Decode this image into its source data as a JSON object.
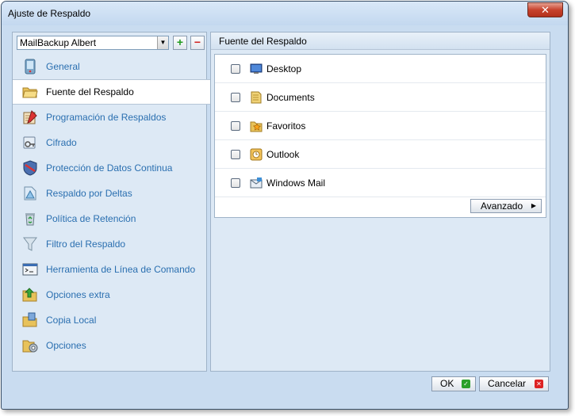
{
  "window": {
    "title": "Ajuste de Respaldo",
    "close_glyph": "✕"
  },
  "profile": {
    "selected": "MailBackup Albert",
    "add_glyph": "+",
    "remove_glyph": "−"
  },
  "nav": {
    "items": [
      {
        "label": "General",
        "icon": "mobile-icon"
      },
      {
        "label": "Fuente del Respaldo",
        "icon": "folder-open-icon",
        "active": true
      },
      {
        "label": "Programación de Respaldos",
        "icon": "schedule-icon"
      },
      {
        "label": "Cifrado",
        "icon": "key-icon"
      },
      {
        "label": "Protección de Datos Continua",
        "icon": "shield-icon"
      },
      {
        "label": "Respaldo por Deltas",
        "icon": "delta-icon"
      },
      {
        "label": "Política de Retención",
        "icon": "recycle-icon"
      },
      {
        "label": "Filtro del Respaldo",
        "icon": "funnel-icon"
      },
      {
        "label": "Herramienta de Línea de Comando",
        "icon": "terminal-icon"
      },
      {
        "label": "Opciones extra",
        "icon": "folder-arrow-icon"
      },
      {
        "label": "Copia Local",
        "icon": "folder-copy-icon"
      },
      {
        "label": "Opciones",
        "icon": "gear-folder-icon"
      }
    ]
  },
  "source_panel": {
    "header": "Fuente del Respaldo",
    "items": [
      {
        "label": "Desktop",
        "icon": "desktop-icon",
        "checked": false
      },
      {
        "label": "Documents",
        "icon": "documents-icon",
        "checked": false
      },
      {
        "label": "Favoritos",
        "icon": "favorites-star-icon",
        "checked": false
      },
      {
        "label": "Outlook",
        "icon": "outlook-icon",
        "checked": false
      },
      {
        "label": "Windows Mail",
        "icon": "windows-mail-icon",
        "checked": false
      }
    ],
    "advanced_label": "Avanzado",
    "advanced_arrow": "▶"
  },
  "footer": {
    "ok_label": "OK",
    "ok_glyph": "✓",
    "cancel_label": "Cancelar",
    "cancel_glyph": "✕"
  }
}
